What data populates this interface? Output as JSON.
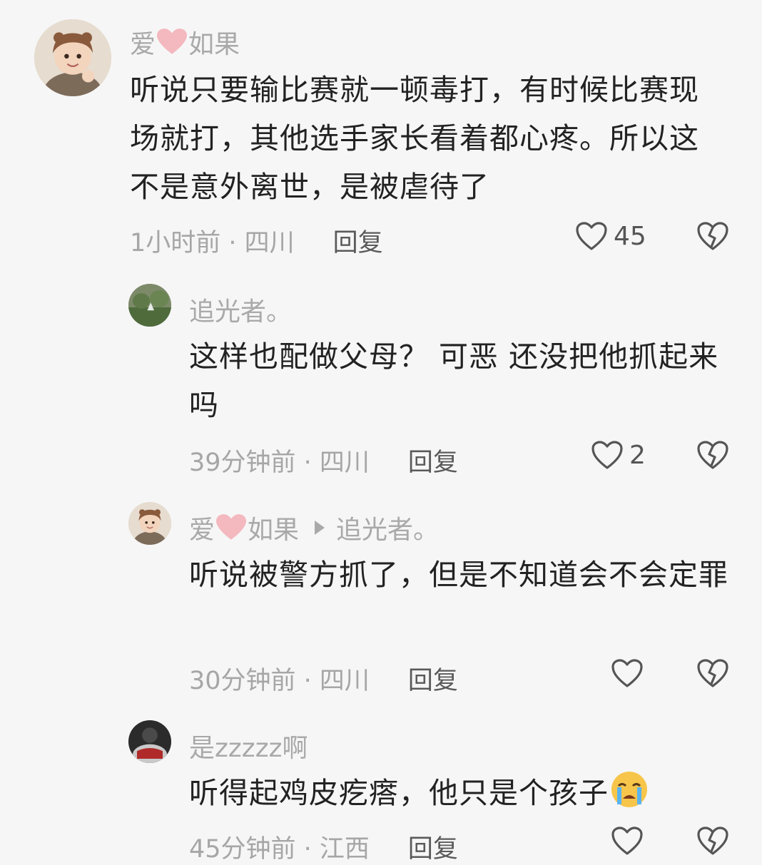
{
  "comments": [
    {
      "user": {
        "name_left": "爱",
        "name_right": "如果"
      },
      "text": "听说只要输比赛就一顿毒打，有时候比赛现场就打，其他选手家长看着都心疼。所以这不是意外离世，是被虐待了",
      "meta": {
        "time_location": "1小时前 · 四川",
        "reply": "回复"
      },
      "likes": "45",
      "avatar_icon": "avatar-girl-icon"
    },
    {
      "user": {
        "name": "追光者。"
      },
      "text": "这样也配做父母？ 可恶  还没把他抓起来吗",
      "meta": {
        "time_location": "39分钟前 · 四川",
        "reply": "回复"
      },
      "likes": "2",
      "avatar_icon": "avatar-landscape-icon"
    },
    {
      "user": {
        "name_left": "爱",
        "name_right": "如果",
        "reply_to": "追光者。"
      },
      "text": "听说被警方抓了，但是不知道会不会定罪",
      "meta": {
        "time_location": "30分钟前 · 四川",
        "reply": "回复"
      },
      "likes": "",
      "avatar_icon": "avatar-girl-icon"
    },
    {
      "user": {
        "name": "是zzzzz啊"
      },
      "text": "听得起鸡皮疙瘩，他只是个孩子",
      "meta": {
        "time_location": "45分钟前 · 江西",
        "reply": "回复"
      },
      "likes": "",
      "avatar_icon": "avatar-dark-icon"
    }
  ],
  "colors": {
    "background": "#f6f6f6",
    "secondary_text": "#a9a9a9",
    "heart_emoji": "#f4b8bf"
  }
}
